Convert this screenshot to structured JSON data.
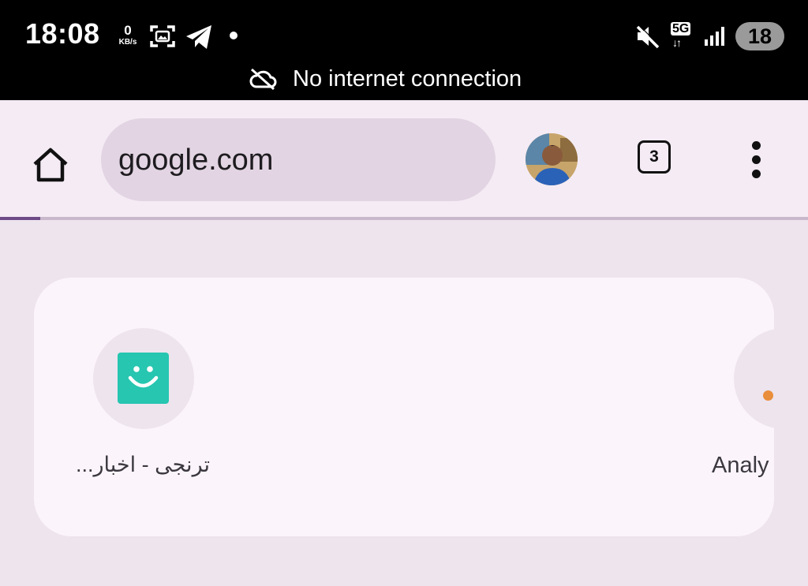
{
  "status_bar": {
    "time": "18:08",
    "net_speed_value": "0",
    "net_speed_unit": "KB/s",
    "network_type": "5G",
    "battery": "18",
    "connection_message": "No internet connection",
    "icons": [
      "screenshot-icon",
      "telegram-icon",
      "notification-dot-icon",
      "mute-icon",
      "signal-icon",
      "cloud-off-icon"
    ]
  },
  "toolbar": {
    "url": "google.com",
    "tab_count": "3",
    "page_load_progress": 0.05
  },
  "shortcuts": [
    {
      "label": "ترنجی - اخبار...",
      "icon": "smiley-logo-icon",
      "color": "#26c6b0"
    },
    {
      "label": "Analy",
      "icon": "analytics-logo-icon",
      "color": "#e98e3b"
    }
  ],
  "colors": {
    "status_bar": "#000000",
    "toolbar": "#f4ebf4",
    "omnibox": "#e2d4e2",
    "progress": "#6e4a86",
    "page_bg": "#ede4ee",
    "card": "#fcf4fb"
  }
}
